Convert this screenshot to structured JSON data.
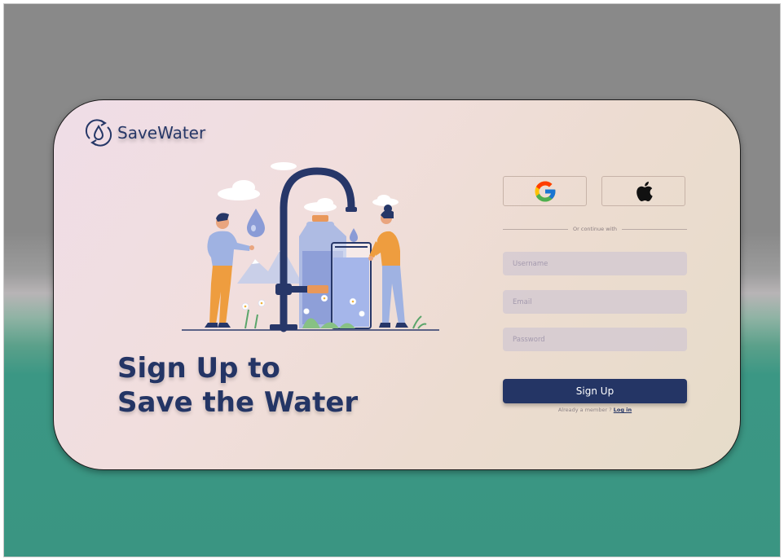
{
  "brand": {
    "name": "SaveWater",
    "icon": "water-drop-recycle-icon"
  },
  "hero": {
    "line1": "Sign Up to",
    "line2": "Save the Water"
  },
  "social": {
    "google_icon": "google-icon",
    "apple_icon": "apple-icon",
    "divider_text": "Or continue with"
  },
  "form": {
    "username_placeholder": "Username",
    "email_placeholder": "Email",
    "password_placeholder": "Password",
    "submit_label": "Sign Up"
  },
  "footer": {
    "member_text": "Already a member ?",
    "login_link": "Log in"
  },
  "colors": {
    "primary": "#243565",
    "teal": "#3a9582",
    "card": "#efdde7"
  }
}
